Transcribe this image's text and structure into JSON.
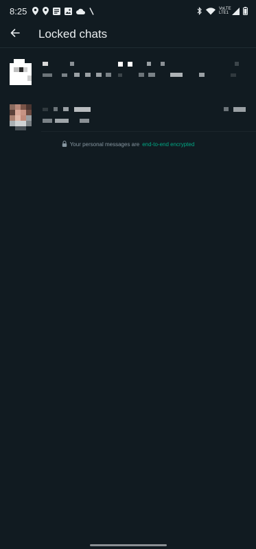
{
  "status_bar": {
    "time": "8:25",
    "network_label": "VoLTE LTE1"
  },
  "app_bar": {
    "title": "Locked chats",
    "back_icon": "arrow-left-icon"
  },
  "chats": [
    {
      "name": "",
      "preview": "",
      "time": "",
      "avatar": "pixelated-avatar"
    },
    {
      "name": "",
      "preview": "",
      "time": "",
      "avatar": "pixelated-avatar"
    }
  ],
  "encryption_notice": {
    "text": "Your personal messages are",
    "link": "end-to-end encrypted",
    "icon": "lock-icon"
  },
  "colors": {
    "background": "#111b21",
    "primary_text": "#e9edef",
    "secondary_text": "#8696a0",
    "accent": "#00a884"
  }
}
